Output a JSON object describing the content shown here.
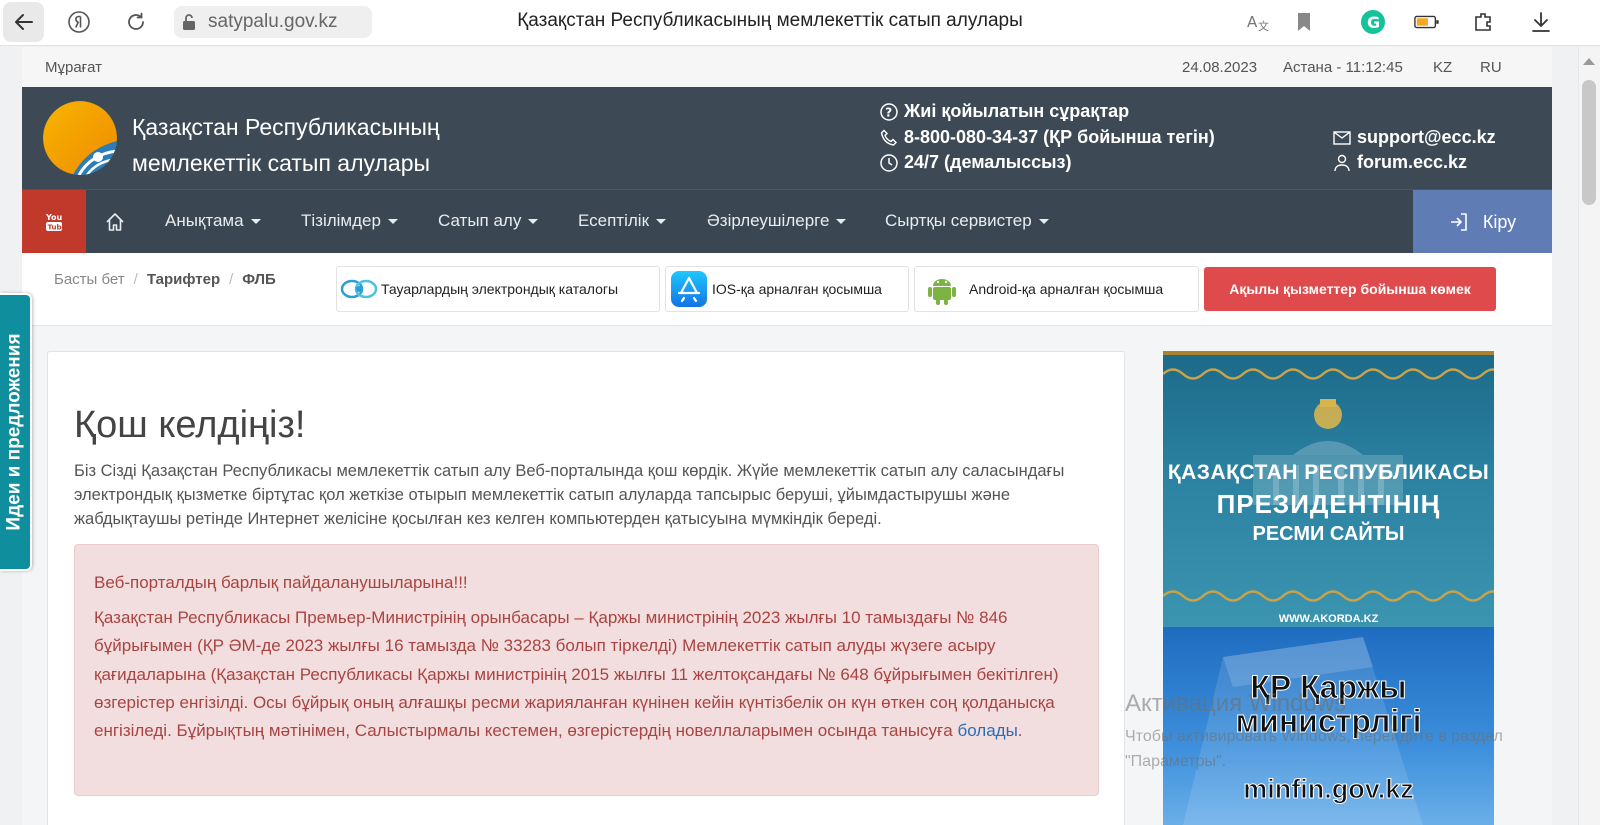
{
  "browser": {
    "url": "satypalu.gov.kz",
    "tab_title": "Қазақстан Республикасының мемлекеттік сатып алулары"
  },
  "topbar": {
    "archive": "Мұрағат",
    "date": "24.08.2023",
    "time": "Астана - 11:12:45",
    "lang_kz": "KZ",
    "lang_ru": "RU"
  },
  "header": {
    "title_line1": "Қазақстан Республикасының",
    "title_line2": "мемлекеттік сатып алулары",
    "faq": "Жиі қойылатын сұрақтар",
    "phone": "8-800-080-34-37 (ҚР бойынша тегін)",
    "hours": "24/7 (демалыссыз)",
    "email": "support@ecc.kz",
    "forum": "forum.ecc.kz"
  },
  "nav": {
    "items": [
      "Анықтама",
      "Тізілімдер",
      "Сатып алу",
      "Есептілік",
      "Әзірлеушілерге",
      "Сыртқы сервистер"
    ],
    "login": "Кіру"
  },
  "breadcrumb": [
    "Басты бет",
    "Тарифтер",
    "ФЛБ"
  ],
  "apps": {
    "catalog": "Тауарлардың электрондық каталогы",
    "ios": "IOS-қа арналған қосымша",
    "android": "Android-қа арналған қосымша",
    "help": "Ақылы қызметтер бойынша көмек"
  },
  "main": {
    "welcome": "Қош келдіңіз!",
    "intro": "Біз Сізді Қазақстан Республикасы мемлекеттік сатып алу Веб-порталында қош көрдік. Жүйе мемлекеттік сатып алу саласындағы электрондық қызметке біртұтас қол жеткізе отырып мемлекеттік сатып алуларда тапсырыс беруші, ұйымдастырушы және жабдықтаушы ретінде Интернет желісіне қосылған кез келген компьютерден қатысуына мүмкіндік береді.",
    "alert_title": "Веб-порталдың барлық пайдаланушыларына!!!",
    "alert_body": "Қазақстан Республикасы Премьер-Министрінің орынбасары – Қаржы министрінің 2023 жылғы 10 тамыздағы № 846 бұйрығымен (ҚР ӘМ-де 2023 жылғы 16 тамызда № 33283 болып тіркелді) Мемлекеттік сатып алуды жүзеге асыру қағидаларына (Қазақстан Республикасы Қаржы министрінің 2015 жылғы 11 желтоқсандағы № 648 бұйрығымен бекітілген) өзгерістер енгізілді. Осы бұйрық оның алғашқы ресми жарияланған күнінен кейін күнтізбелік он күн өткен соң қолданысқа енгізіледі. Бұйрықтың мәтінімен, Салыстырмалы кестемен, өзгерістердің новеллаларымен осында танысуға",
    "alert_link": "болады",
    "alert_end": "."
  },
  "banners": {
    "akorda_line1": "ҚАЗАҚСТАН РЕСПУБЛИКАСЫ",
    "akorda_line2": "ПРЕЗИДЕНТІНІҢ",
    "akorda_line3": "РЕСМИ САЙТЫ",
    "akorda_url": "WWW.AKORDA.KZ",
    "minfin_line1": "ҚР Қаржы",
    "minfin_line2": "министрлігі",
    "minfin_url": "minfin.gov.kz"
  },
  "side_tab": "Идеи и предложения",
  "watermark": {
    "title": "Активация Windows",
    "text": "Чтобы активировать Windows, перейдите в раздел \"Параметры\"."
  },
  "colors": {
    "header_bg": "#3d4a56",
    "nav_bg": "#3a4651",
    "youtube_red": "#c0392b",
    "login_blue": "#5f7cb5",
    "help_red": "#df4b4d",
    "alert_text": "#a94442",
    "side_tab_teal": "#0f8f9e"
  }
}
